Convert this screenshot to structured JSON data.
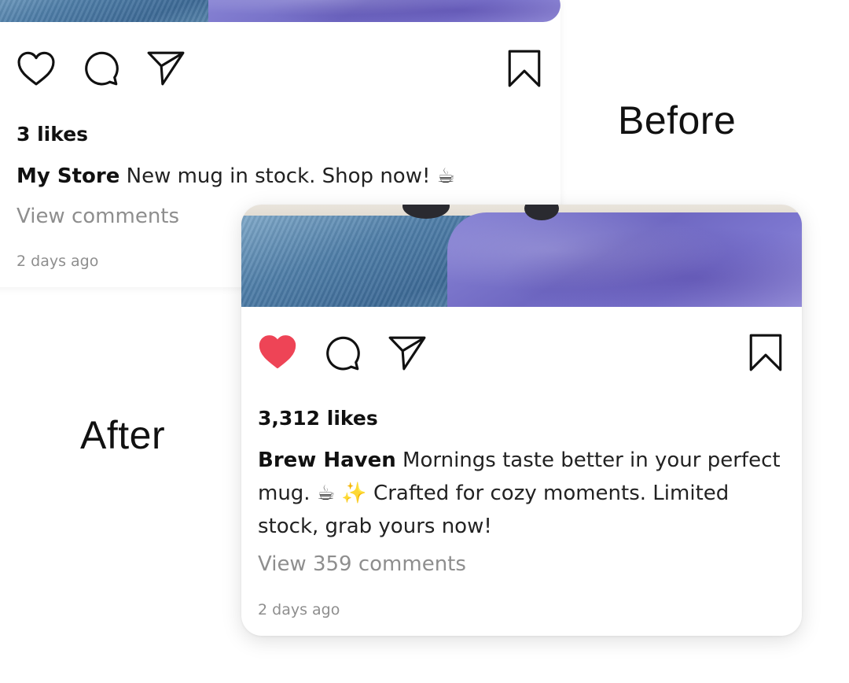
{
  "before_label": "Before",
  "after_label": "After",
  "before_post": {
    "likes": "3 likes",
    "username": "My Store",
    "caption": "New mug in stock. Shop now! ☕",
    "view_comments": "View comments",
    "timestamp": "2 days ago",
    "liked": false
  },
  "after_post": {
    "likes": "3,312 likes",
    "username": "Brew Haven",
    "caption": "Mornings taste better in your perfect mug. ☕ ✨ Crafted for cozy moments. Limited stock, grab yours now!",
    "view_comments": "View 359 comments",
    "timestamp": "2 days ago",
    "liked": true
  },
  "icons": {
    "like": "heart-icon",
    "comment": "comment-icon",
    "share": "paper-plane-icon",
    "save": "bookmark-icon"
  },
  "colors": {
    "liked_heart": "#ee4456",
    "muted_text": "#8e8e8e"
  }
}
